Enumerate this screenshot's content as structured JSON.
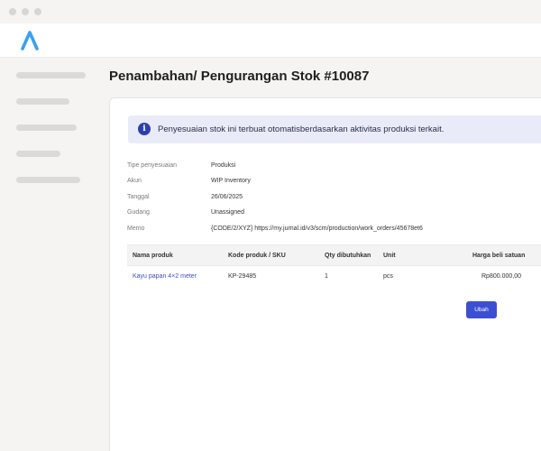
{
  "page": {
    "title": "Penambahan/ Pengurangan Stok #10087"
  },
  "banner": {
    "icon": "info-icon",
    "icon_glyph": "i",
    "text": "Penyesuaian stok ini terbuat otomatisberdasarkan aktivitas produksi terkait."
  },
  "details": [
    {
      "label": "Tipe penyesuaian",
      "value": "Produksi"
    },
    {
      "label": "Akun",
      "value": "WIP Inventory"
    },
    {
      "label": "Tanggal",
      "value": "26/06/2025"
    },
    {
      "label": "Gudang",
      "value": "Unassigned"
    },
    {
      "label": "Memo",
      "value": "{CODE/2/XYZ} https://my.jurnal.id/v3/scm/production/work_orders/45678et6"
    }
  ],
  "table": {
    "headers": [
      "Nama produk",
      "Kode produk / SKU",
      "Qty dibutuhkan",
      "Unit",
      "Harga beli satuan"
    ],
    "rows": [
      [
        "Kayu papan 4×2 meter",
        "KP-29485",
        "1",
        "pcs",
        "Rp800.000,00"
      ]
    ]
  },
  "actions": {
    "edit_label": "Ubah"
  },
  "colors": {
    "accent": "#3d4fd1",
    "banner_bg": "#e9ecf8",
    "logo": "#3aa0f0"
  }
}
